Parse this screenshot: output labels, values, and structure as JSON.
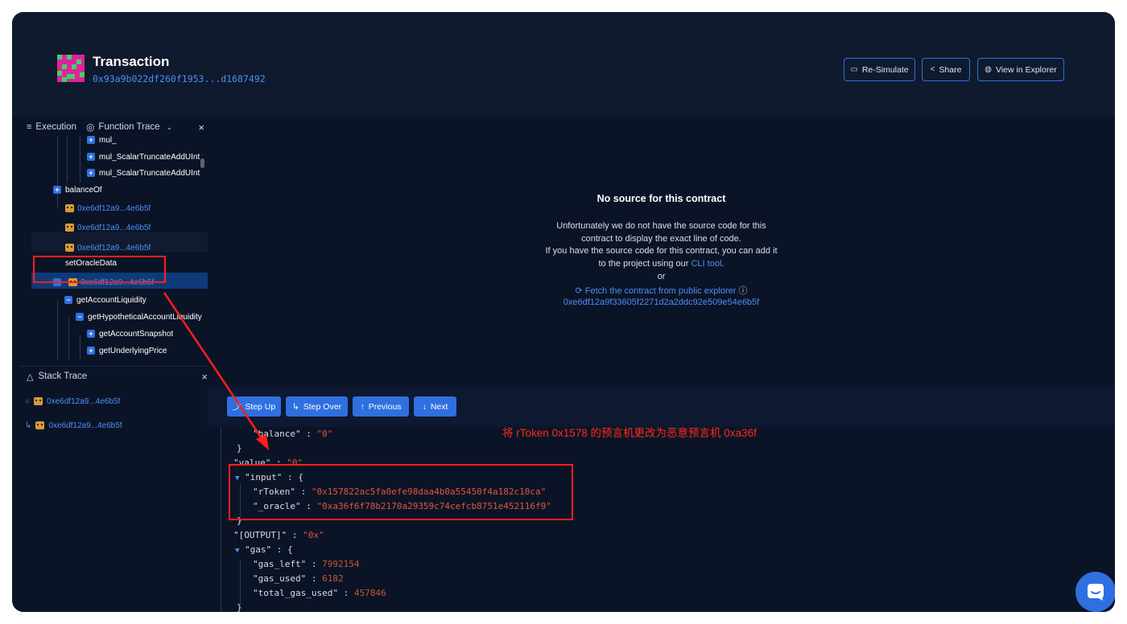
{
  "header": {
    "title": "Transaction",
    "hash": "0x93a9b022df260f1953...d1687492",
    "buttons": {
      "resimulate": "Re-Simulate",
      "share": "Share",
      "explorer": "View in Explorer"
    }
  },
  "left_panel": {
    "tabs": {
      "execution": "Execution",
      "function_trace": "Function Trace",
      "close": "×"
    },
    "tree": {
      "mul": "mul_",
      "mul_scalar_1": "mul_ScalarTruncateAddUInt",
      "mul_scalar_2": "mul_ScalarTruncateAddUInt",
      "balance_of": "balanceOf",
      "contract_1": "0xe6df12a9...4e6b5f",
      "contract_2": "0xe6df12a9...4e6b5f",
      "contract_3": "0xe6df12a9...4e6b5f",
      "set_oracle_data": "setOracleData",
      "contract_4": "0xe6df12a9...4e6b5f",
      "get_account_liquidity": "getAccountLiquidity",
      "get_hypothetical": "getHypotheticalAccountLiquidity",
      "get_account_snapshot": "getAccountSnapshot",
      "get_underlying_price": "getUnderlyingPrice"
    },
    "stack_trace": {
      "title": "Stack Trace",
      "close": "×",
      "rows": [
        "0xe6df12a9...4e6b5f",
        "0xe6df12a9...4e6b5f"
      ]
    }
  },
  "no_source": {
    "title": "No source for this contract",
    "line1": "Unfortunately we do not have the source code for this",
    "line2": "contract to display the exact line of code.",
    "line3": "If you have the source code for this contract, you can add it",
    "line4_prefix": "to the project using our ",
    "cli_link": "CLI tool",
    "line4_suffix": ".",
    "or": "or",
    "fetch": "Fetch the contract from public explorer",
    "address": "0xe6df12a9f33605f2271d2a2ddc92e509e54e6b5f"
  },
  "debug": {
    "buttons": {
      "step_up": "Step Up",
      "step_over": "Step Over",
      "previous": "Previous",
      "next": "Next"
    },
    "code": {
      "balance_key": "\"balance\"",
      "balance_val": "\"0\"",
      "value_key": "\"value\"",
      "value_val": "\"0\"",
      "input_key": "\"input\"",
      "rtoken_key": "\"rToken\"",
      "rtoken_val": "\"0x157822ac5fa0efe98daa4b0a55450f4a182c10ca\"",
      "oracle_key": "\"_oracle\"",
      "oracle_val": "\"0xa36f6f78b2170a29359c74cefcb8751e452116f9\"",
      "output_key": "\"[OUTPUT]\"",
      "output_val": "\"0x\"",
      "gas_key": "\"gas\"",
      "gas_left_key": "\"gas_left\"",
      "gas_left_val": "7992154",
      "gas_used_key": "\"gas_used\"",
      "gas_used_val": "6182",
      "total_gas_key": "\"total_gas_used\"",
      "total_gas_val": "457846"
    }
  },
  "annotation": {
    "text": "将 rToken 0x1578 的预言机更改为恶意预言机 0xa36f"
  },
  "colors": {
    "background": "#0b1426",
    "accent": "#2f6fe0",
    "link": "#4d8ef7",
    "annotation": "#ff1e1e"
  },
  "icons": {
    "execution": "list-icon",
    "function_trace": "target-icon",
    "stack_trace": "warning-triangle-icon",
    "chat": "chat-bubble-icon"
  }
}
